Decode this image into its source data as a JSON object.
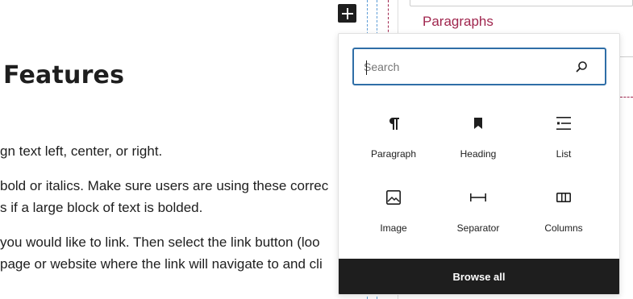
{
  "editor": {
    "heading": "Features",
    "paragraphs": [
      "gn text left, center, or right.",
      "bold or italics. Make sure users are using these correc",
      "s if a large block of text is bolded.",
      "you would like to link. Then select the link button (loo",
      "page or website where the link will navigate to and cli"
    ]
  },
  "sidebar": {
    "label": "Paragraphs"
  },
  "toolbar": {
    "add_block_icon": "plus-icon"
  },
  "inserter": {
    "search": {
      "placeholder": "Search",
      "icon": "search-icon"
    },
    "blocks": [
      {
        "label": "Paragraph",
        "icon": "paragraph-icon"
      },
      {
        "label": "Heading",
        "icon": "bookmark-icon"
      },
      {
        "label": "List",
        "icon": "list-icon"
      },
      {
        "label": "Image",
        "icon": "image-icon"
      },
      {
        "label": "Separator",
        "icon": "separator-icon"
      },
      {
        "label": "Columns",
        "icon": "columns-icon"
      }
    ],
    "browse_all": "Browse all"
  },
  "colors": {
    "accent": "#2f6ea7",
    "dark": "#1e1e1e",
    "link": "#a0264e"
  }
}
